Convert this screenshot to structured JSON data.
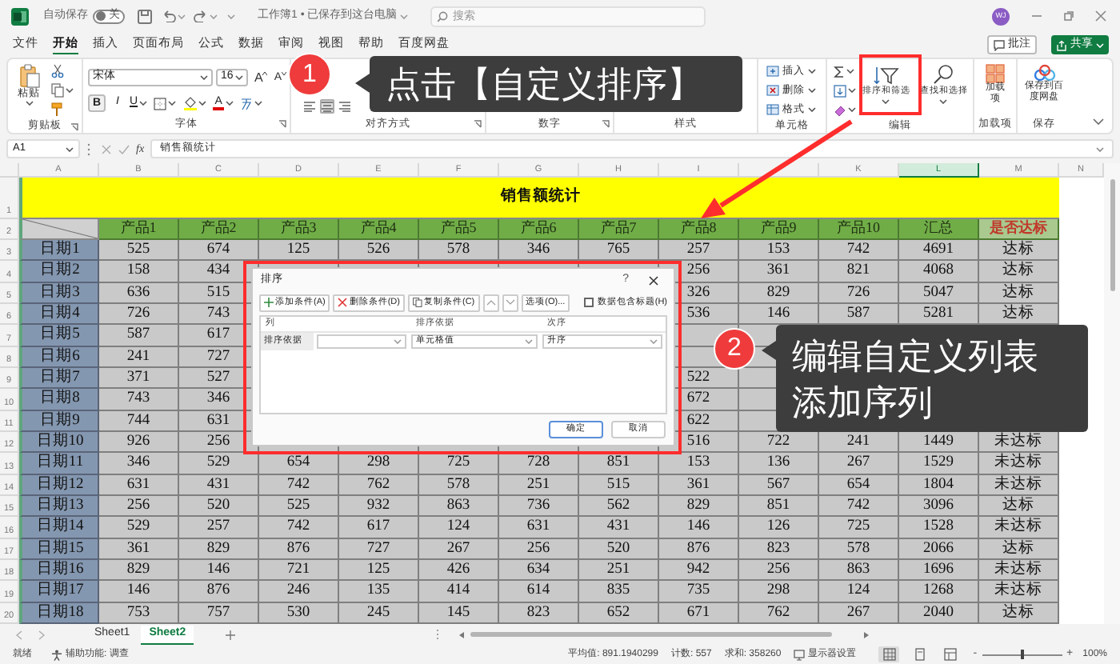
{
  "title_bar": {
    "autosave": "自动保存",
    "autosave_switch": {
      "label": "关",
      "on": false
    },
    "document": "工作簿1 • 已保存到这台电脑",
    "search": {
      "placeholder": "搜索"
    },
    "avatar": "WJ"
  },
  "tabs": [
    {
      "label": "文件",
      "selected": false
    },
    {
      "label": "开始",
      "selected": true
    },
    {
      "label": "插入",
      "selected": false
    },
    {
      "label": "页面布局",
      "selected": false
    },
    {
      "label": "公式",
      "selected": false
    },
    {
      "label": "数据",
      "selected": false
    },
    {
      "label": "审阅",
      "selected": false
    },
    {
      "label": "视图",
      "selected": false
    },
    {
      "label": "帮助",
      "selected": false
    },
    {
      "label": "百度网盘",
      "selected": false
    }
  ],
  "header_actions": [
    {
      "kind": "comment",
      "label": "批注"
    },
    {
      "kind": "share",
      "label": "共享"
    }
  ],
  "ribbon": {
    "clipboard": {
      "paste": "粘贴",
      "label": "剪贴板"
    },
    "font": {
      "name": "宋体",
      "size": "16",
      "grow": "A",
      "shrink": "A",
      "bold": "B",
      "italic": "I",
      "underline": "U",
      "font_color": "A",
      "label": "字体"
    },
    "alignment": {
      "label": "对齐方式"
    },
    "number": {
      "label": "数字"
    },
    "styles": {
      "label": "样式"
    },
    "cells": {
      "items": [
        {
          "kind": "insert",
          "label": "插入"
        },
        {
          "kind": "delete",
          "label": "删除"
        },
        {
          "kind": "format",
          "label": "格式"
        }
      ],
      "label": "单元格"
    },
    "editing": {
      "sort_filter": "排序和筛选",
      "find_select": "查找和选择",
      "label": "编辑"
    },
    "addins": {
      "button": "加载项",
      "label": "加载项"
    },
    "save": {
      "button": "保存到百度网盘",
      "label": "保存"
    }
  },
  "formula_bar": {
    "name_box": "A1",
    "function_symbol": "fx",
    "formula": "销售额统计"
  },
  "sheet": {
    "column_letters": [
      {
        "letter": "A",
        "selected": false
      },
      {
        "letter": "B",
        "selected": false
      },
      {
        "letter": "C",
        "selected": false
      },
      {
        "letter": "D",
        "selected": false
      },
      {
        "letter": "E",
        "selected": false
      },
      {
        "letter": "F",
        "selected": false
      },
      {
        "letter": "G",
        "selected": false
      },
      {
        "letter": "H",
        "selected": false
      },
      {
        "letter": "I",
        "selected": false
      },
      {
        "selected": false
      },
      {
        "letter": "K",
        "selected": false
      },
      {
        "letter": "L",
        "selected": true
      },
      {
        "letter": "M",
        "selected": false
      },
      {
        "letter": "N",
        "selected": false
      }
    ],
    "row_numbers": [
      "1",
      "2",
      "3",
      "4",
      "5",
      "6",
      "7",
      "8",
      "9",
      "10",
      "11",
      "12",
      "13",
      "14",
      "15",
      "16",
      "17",
      "18",
      "19",
      "20"
    ],
    "title": "销售额统计",
    "headers": [
      "产品1",
      "产品2",
      "产品3",
      "产品4",
      "产品5",
      "产品6",
      "产品7",
      "产品8",
      "产品9",
      "产品10",
      "汇总",
      "是否达标"
    ],
    "rows": [
      {
        "label": "日期1",
        "cells": [
          "525",
          "674",
          "125",
          "526",
          "578",
          "346",
          "765",
          "257",
          "153",
          "742",
          "4691",
          "达标"
        ]
      },
      {
        "label": "日期2",
        "cells": [
          "158",
          "434",
          null,
          null,
          null,
          null,
          null,
          "256",
          "361",
          "821",
          "4068",
          "达标"
        ]
      },
      {
        "label": "日期3",
        "cells": [
          "636",
          "515",
          null,
          null,
          null,
          null,
          null,
          "326",
          "829",
          "726",
          "5047",
          "达标"
        ]
      },
      {
        "label": "日期4",
        "cells": [
          "726",
          "743",
          null,
          null,
          null,
          null,
          null,
          "536",
          "146",
          "587",
          "5281",
          "达标"
        ]
      },
      {
        "label": "日期5",
        "cells": [
          "587",
          "617",
          null,
          null,
          null,
          null,
          null,
          null,
          null,
          null,
          null,
          null
        ]
      },
      {
        "label": "日期6",
        "cells": [
          "241",
          "727",
          null,
          null,
          null,
          null,
          null,
          null,
          null,
          null,
          null,
          null
        ]
      },
      {
        "label": "日期7",
        "cells": [
          "371",
          "527",
          null,
          null,
          null,
          null,
          null,
          "522",
          null,
          null,
          null,
          null
        ]
      },
      {
        "label": "日期8",
        "cells": [
          "743",
          "346",
          null,
          null,
          null,
          null,
          null,
          "672",
          null,
          null,
          null,
          null
        ]
      },
      {
        "label": "日期9",
        "cells": [
          "744",
          "631",
          null,
          null,
          null,
          null,
          null,
          "622",
          null,
          null,
          null,
          null
        ]
      },
      {
        "label": "日期10",
        "cells": [
          "926",
          "256",
          null,
          null,
          null,
          null,
          null,
          "516",
          "722",
          "241",
          "1449",
          "未达标"
        ]
      },
      {
        "label": "日期11",
        "cells": [
          "346",
          "529",
          "654",
          "298",
          "725",
          "728",
          "851",
          "153",
          "136",
          "267",
          "1529",
          "未达标"
        ]
      },
      {
        "label": "日期12",
        "cells": [
          "631",
          "431",
          "742",
          "762",
          "578",
          "251",
          "515",
          "361",
          "567",
          "654",
          "1804",
          "未达标"
        ]
      },
      {
        "label": "日期13",
        "cells": [
          "256",
          "520",
          "525",
          "932",
          "863",
          "736",
          "562",
          "829",
          "851",
          "742",
          "3096",
          "达标"
        ]
      },
      {
        "label": "日期14",
        "cells": [
          "529",
          "257",
          "742",
          "617",
          "124",
          "631",
          "431",
          "146",
          "126",
          "725",
          "1528",
          "未达标"
        ]
      },
      {
        "label": "日期15",
        "cells": [
          "361",
          "829",
          "876",
          "727",
          "267",
          "256",
          "520",
          "876",
          "823",
          "578",
          "2066",
          "达标"
        ]
      },
      {
        "label": "日期16",
        "cells": [
          "829",
          "146",
          "721",
          "125",
          "426",
          "634",
          "251",
          "942",
          "256",
          "863",
          "1696",
          "未达标"
        ]
      },
      {
        "label": "日期17",
        "cells": [
          "146",
          "876",
          "246",
          "135",
          "414",
          "614",
          "835",
          "735",
          "298",
          "124",
          "1268",
          "未达标"
        ]
      },
      {
        "label": "日期18",
        "cells": [
          "753",
          "757",
          "530",
          "245",
          "145",
          "823",
          "652",
          "671",
          "762",
          "267",
          "2040",
          "达标"
        ]
      }
    ]
  },
  "sort_dialog": {
    "title": "排序",
    "help": "?",
    "toolbar": [
      {
        "kind": "add",
        "label": "添加条件(A)"
      },
      {
        "kind": "delete",
        "label": "删除条件(D)"
      },
      {
        "kind": "copy",
        "label": "复制条件(C)"
      },
      {
        "kind": "up"
      },
      {
        "kind": "down"
      },
      {
        "kind": "options",
        "label": "选项(O)..."
      }
    ],
    "header_checkbox": {
      "label": "数据包含标题(H)",
      "checked": false
    },
    "list_columns": [
      "列",
      "排序依据",
      "次序"
    ],
    "levels": [
      {
        "label": "排序依据",
        "sort_on": "单元格值",
        "order": "升序"
      }
    ],
    "buttons": [
      {
        "kind": "ok",
        "label": "确定"
      },
      {
        "kind": "cancel",
        "label": "取消"
      }
    ]
  },
  "sheet_tabs": [
    {
      "label": "Sheet1",
      "selected": false
    },
    {
      "label": "Sheet2",
      "selected": true
    }
  ],
  "status_bar": {
    "ready": "就绪",
    "accessibility": "辅助功能: 调查",
    "stats": [
      "平均值: 891.1940299",
      "计数: 557",
      "求和: 358260"
    ],
    "display_settings": "显示器设置",
    "views": [
      {
        "kind": "normal",
        "selected": true
      },
      {
        "kind": "page_layout",
        "selected": false
      },
      {
        "kind": "page_break",
        "selected": false
      }
    ],
    "zoom_out": "-",
    "zoom_slider": {
      "level": 0.5
    },
    "zoom_in": "+",
    "zoom": "100%"
  },
  "annotations": [
    {
      "number": "1",
      "lines": [
        "点击【自定义排序】"
      ]
    },
    {
      "number": "2",
      "lines": [
        "编辑自定义列表",
        "添加序列"
      ]
    }
  ]
}
